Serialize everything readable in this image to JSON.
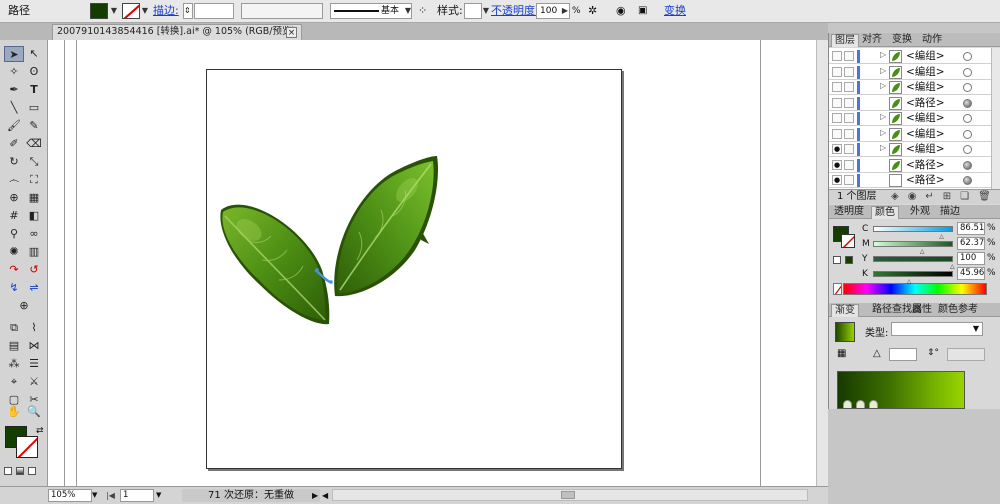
{
  "control_bar": {
    "object_type": "路径",
    "fill_color": "#143d00",
    "stroke_label": "描边:",
    "stroke_weight": "",
    "brush_label": "基本",
    "style_label": "样式:",
    "opacity_label": "不透明度:",
    "opacity_value": "100",
    "percent_sign": "%",
    "transform_label": "变换"
  },
  "document_tab": {
    "title": "2007910143854416 [转换].ai* @ 105% (RGB/预览)",
    "close": "×"
  },
  "status_bar": {
    "zoom": "105%",
    "artboard": "1",
    "status_text": "71 次还原：无重做"
  },
  "panels": {
    "layers_tabs": [
      "图层",
      "对齐",
      "变换",
      "动作"
    ],
    "layers": [
      {
        "name": "<编组>",
        "visible": false,
        "expandable": true,
        "thumb": "leaf",
        "target_filled": false
      },
      {
        "name": "<编组>",
        "visible": false,
        "expandable": true,
        "thumb": "leaf",
        "target_filled": false
      },
      {
        "name": "<编组>",
        "visible": false,
        "expandable": true,
        "thumb": "leaf",
        "target_filled": false
      },
      {
        "name": "<路径>",
        "visible": false,
        "expandable": false,
        "thumb": "leaf",
        "target_filled": true
      },
      {
        "name": "<编组>",
        "visible": false,
        "expandable": true,
        "thumb": "leaf",
        "target_filled": false
      },
      {
        "name": "<编组>",
        "visible": false,
        "expandable": true,
        "thumb": "leaf",
        "target_filled": false
      },
      {
        "name": "<编组>",
        "visible": true,
        "expandable": true,
        "thumb": "leaf",
        "target_filled": false
      },
      {
        "name": "<路径>",
        "visible": true,
        "expandable": false,
        "thumb": "leaf",
        "target_filled": true
      },
      {
        "name": "<路径>",
        "visible": true,
        "expandable": false,
        "thumb": "blank",
        "target_filled": true
      }
    ],
    "layers_count": "1 个图层",
    "color_tabs": [
      "透明度",
      "颜色",
      "外观",
      "描边"
    ],
    "color": {
      "fill": "#143d00",
      "channels": [
        {
          "label": "C",
          "value": "86.51",
          "fraction": 0.8651,
          "gradient": [
            "#ffffff",
            "#00a0e0"
          ]
        },
        {
          "label": "M",
          "value": "62.37",
          "fraction": 0.6237,
          "gradient": [
            "#d4ffd4",
            "#1a5a20"
          ]
        },
        {
          "label": "Y",
          "value": "100",
          "fraction": 1.0,
          "gradient": [
            "#2a5a40",
            "#1a4a20"
          ]
        },
        {
          "label": "K",
          "value": "45.96",
          "fraction": 0.4596,
          "gradient": [
            "#2f7a2f",
            "#000000"
          ]
        }
      ],
      "percent": "%"
    },
    "gradient_tabs": [
      "渐变",
      "路径查找器",
      "属性",
      "颜色参考"
    ],
    "gradient": {
      "type_label": "类型:",
      "type_value": "",
      "stops": [
        0.07,
        0.17,
        0.27
      ]
    }
  }
}
